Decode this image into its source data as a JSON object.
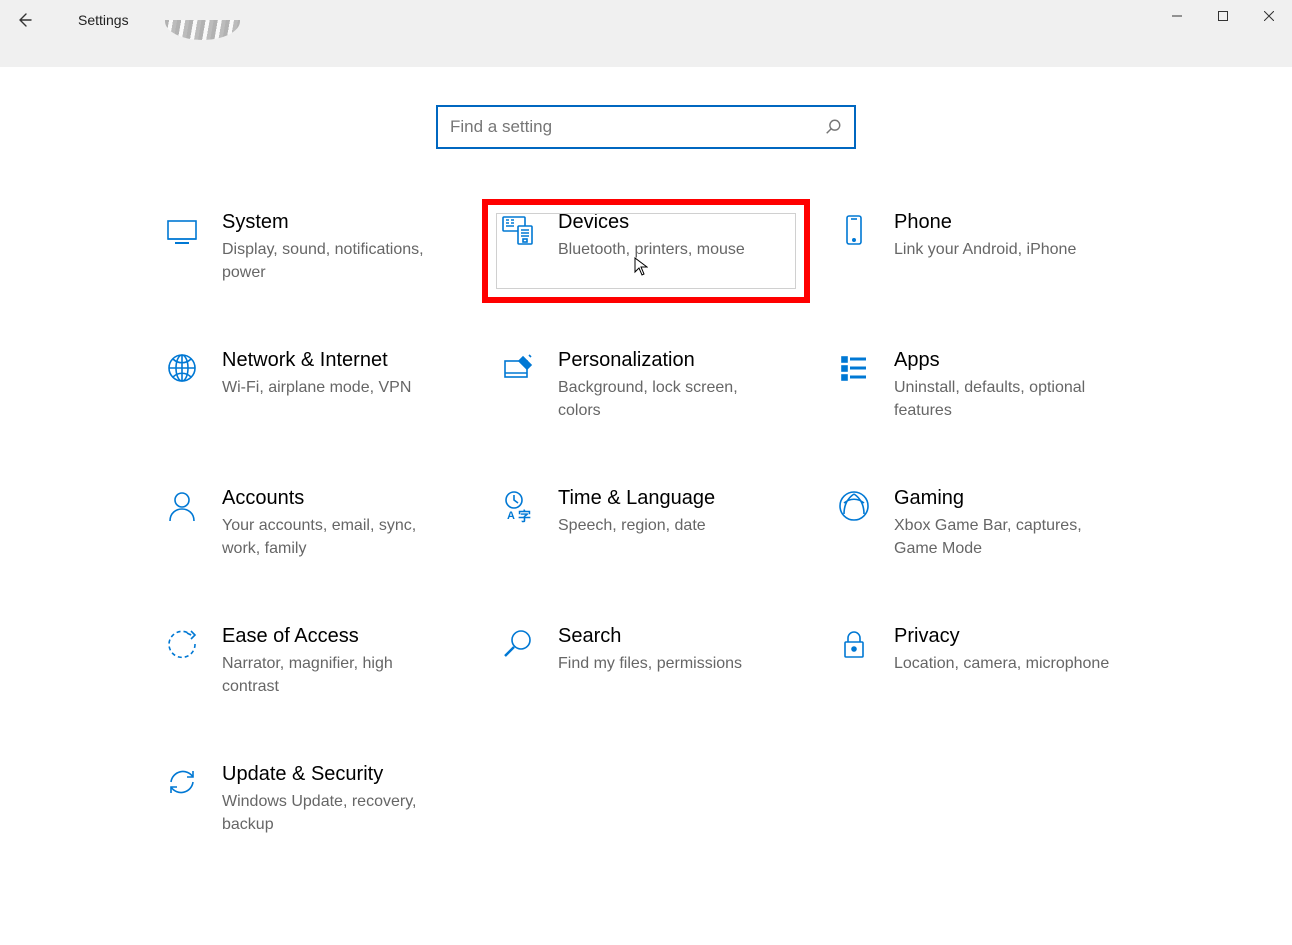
{
  "window": {
    "title": "Settings"
  },
  "search": {
    "placeholder": "Find a setting"
  },
  "tiles": [
    {
      "id": "system",
      "title": "System",
      "desc": "Display, sound, notifications, power"
    },
    {
      "id": "devices",
      "title": "Devices",
      "desc": "Bluetooth, printers, mouse",
      "highlight": true
    },
    {
      "id": "phone",
      "title": "Phone",
      "desc": "Link your Android, iPhone"
    },
    {
      "id": "network",
      "title": "Network & Internet",
      "desc": "Wi-Fi, airplane mode, VPN"
    },
    {
      "id": "personalization",
      "title": "Personalization",
      "desc": "Background, lock screen, colors"
    },
    {
      "id": "apps",
      "title": "Apps",
      "desc": "Uninstall, defaults, optional features"
    },
    {
      "id": "accounts",
      "title": "Accounts",
      "desc": "Your accounts, email, sync, work, family"
    },
    {
      "id": "time",
      "title": "Time & Language",
      "desc": "Speech, region, date"
    },
    {
      "id": "gaming",
      "title": "Gaming",
      "desc": "Xbox Game Bar, captures, Game Mode"
    },
    {
      "id": "ease",
      "title": "Ease of Access",
      "desc": "Narrator, magnifier, high contrast"
    },
    {
      "id": "search",
      "title": "Search",
      "desc": "Find my files, permissions"
    },
    {
      "id": "privacy",
      "title": "Privacy",
      "desc": "Location, camera, microphone"
    },
    {
      "id": "update",
      "title": "Update & Security",
      "desc": "Windows Update, recovery, backup"
    }
  ],
  "colors": {
    "accent": "#0078d4",
    "highlight": "#ff0000",
    "search_border": "#0067c0"
  }
}
